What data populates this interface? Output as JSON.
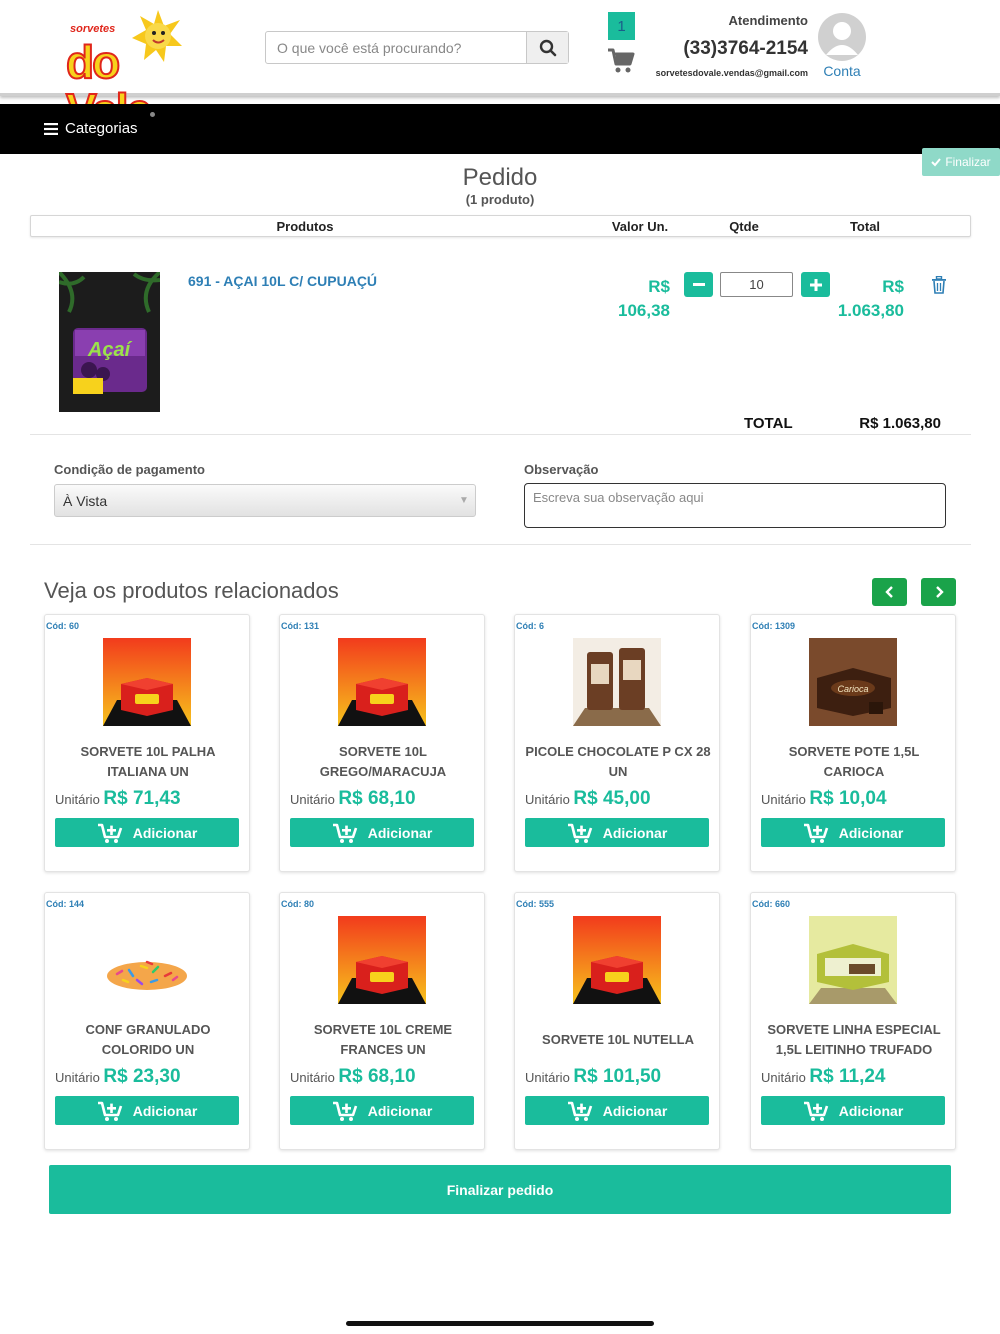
{
  "header": {
    "logo_small": "sorvetes",
    "logo_big": "do Vale",
    "search_placeholder": "O que você está procurando?",
    "cart_count": "1",
    "support_label": "Atendimento",
    "support_phone": "(33)3764-2154",
    "support_email": "sorvetesdovale.vendas@gmail.com",
    "account_label": "Conta"
  },
  "nav": {
    "categories_label": "Categorias",
    "finalize_top_label": "Finalizar"
  },
  "order": {
    "title": "Pedido",
    "subtitle": "(1 produto)",
    "columns": [
      "Produtos",
      "Valor Un.",
      "Qtde",
      "Total"
    ],
    "item": {
      "name": "691 - AÇAI 10L C/ CUPUAÇÚ",
      "unit_currency": "R$",
      "unit_value": "106,38",
      "quantity": "10",
      "total_currency": "R$",
      "total_value": "1.063,80",
      "image_label": "Açaí"
    },
    "total_label": "TOTAL",
    "total_value": "R$ 1.063,80"
  },
  "payment": {
    "label": "Condição de pagamento",
    "selected": "À Vista"
  },
  "observation": {
    "label": "Observação",
    "placeholder": "Escreva sua observação aqui"
  },
  "related": {
    "title": "Veja os produtos relacionados",
    "price_prefix": "Unitário",
    "add_label": "Adicionar",
    "products": [
      {
        "code": "Cód: 60",
        "name": "SORVETE 10L PALHA ITALIANA UN",
        "price": "R$ 71,43",
        "img": "box"
      },
      {
        "code": "Cód: 131",
        "name": "SORVETE 10L GREGO/MARACUJA",
        "price": "R$ 68,10",
        "img": "box"
      },
      {
        "code": "Cód: 6",
        "name": "PICOLE CHOCOLATE P CX 28 UN",
        "price": "R$ 45,00",
        "img": "picole"
      },
      {
        "code": "Cód: 1309",
        "name": "SORVETE POTE 1,5L CARIOCA",
        "price": "R$ 10,04",
        "img": "pote"
      },
      {
        "code": "Cód: 144",
        "name": "CONF GRANULADO COLORIDO UN",
        "price": "R$ 23,30",
        "img": "granulado"
      },
      {
        "code": "Cód: 80",
        "name": "SORVETE 10L CREME FRANCES UN",
        "price": "R$ 68,10",
        "img": "box"
      },
      {
        "code": "Cód: 555",
        "name": "SORVETE 10L NUTELLA",
        "price": "R$ 101,50",
        "img": "box"
      },
      {
        "code": "Cód: 660",
        "name": "SORVETE LINHA ESPECIAL 1,5L LEITINHO TRUFADO",
        "price": "R$ 11,24",
        "img": "especial"
      }
    ]
  },
  "finalize_label": "Finalizar pedido",
  "colors": {
    "accent": "#1abc9c",
    "link": "#2e7fb5",
    "nav_green": "#1aa34a",
    "bar": "#000000"
  }
}
